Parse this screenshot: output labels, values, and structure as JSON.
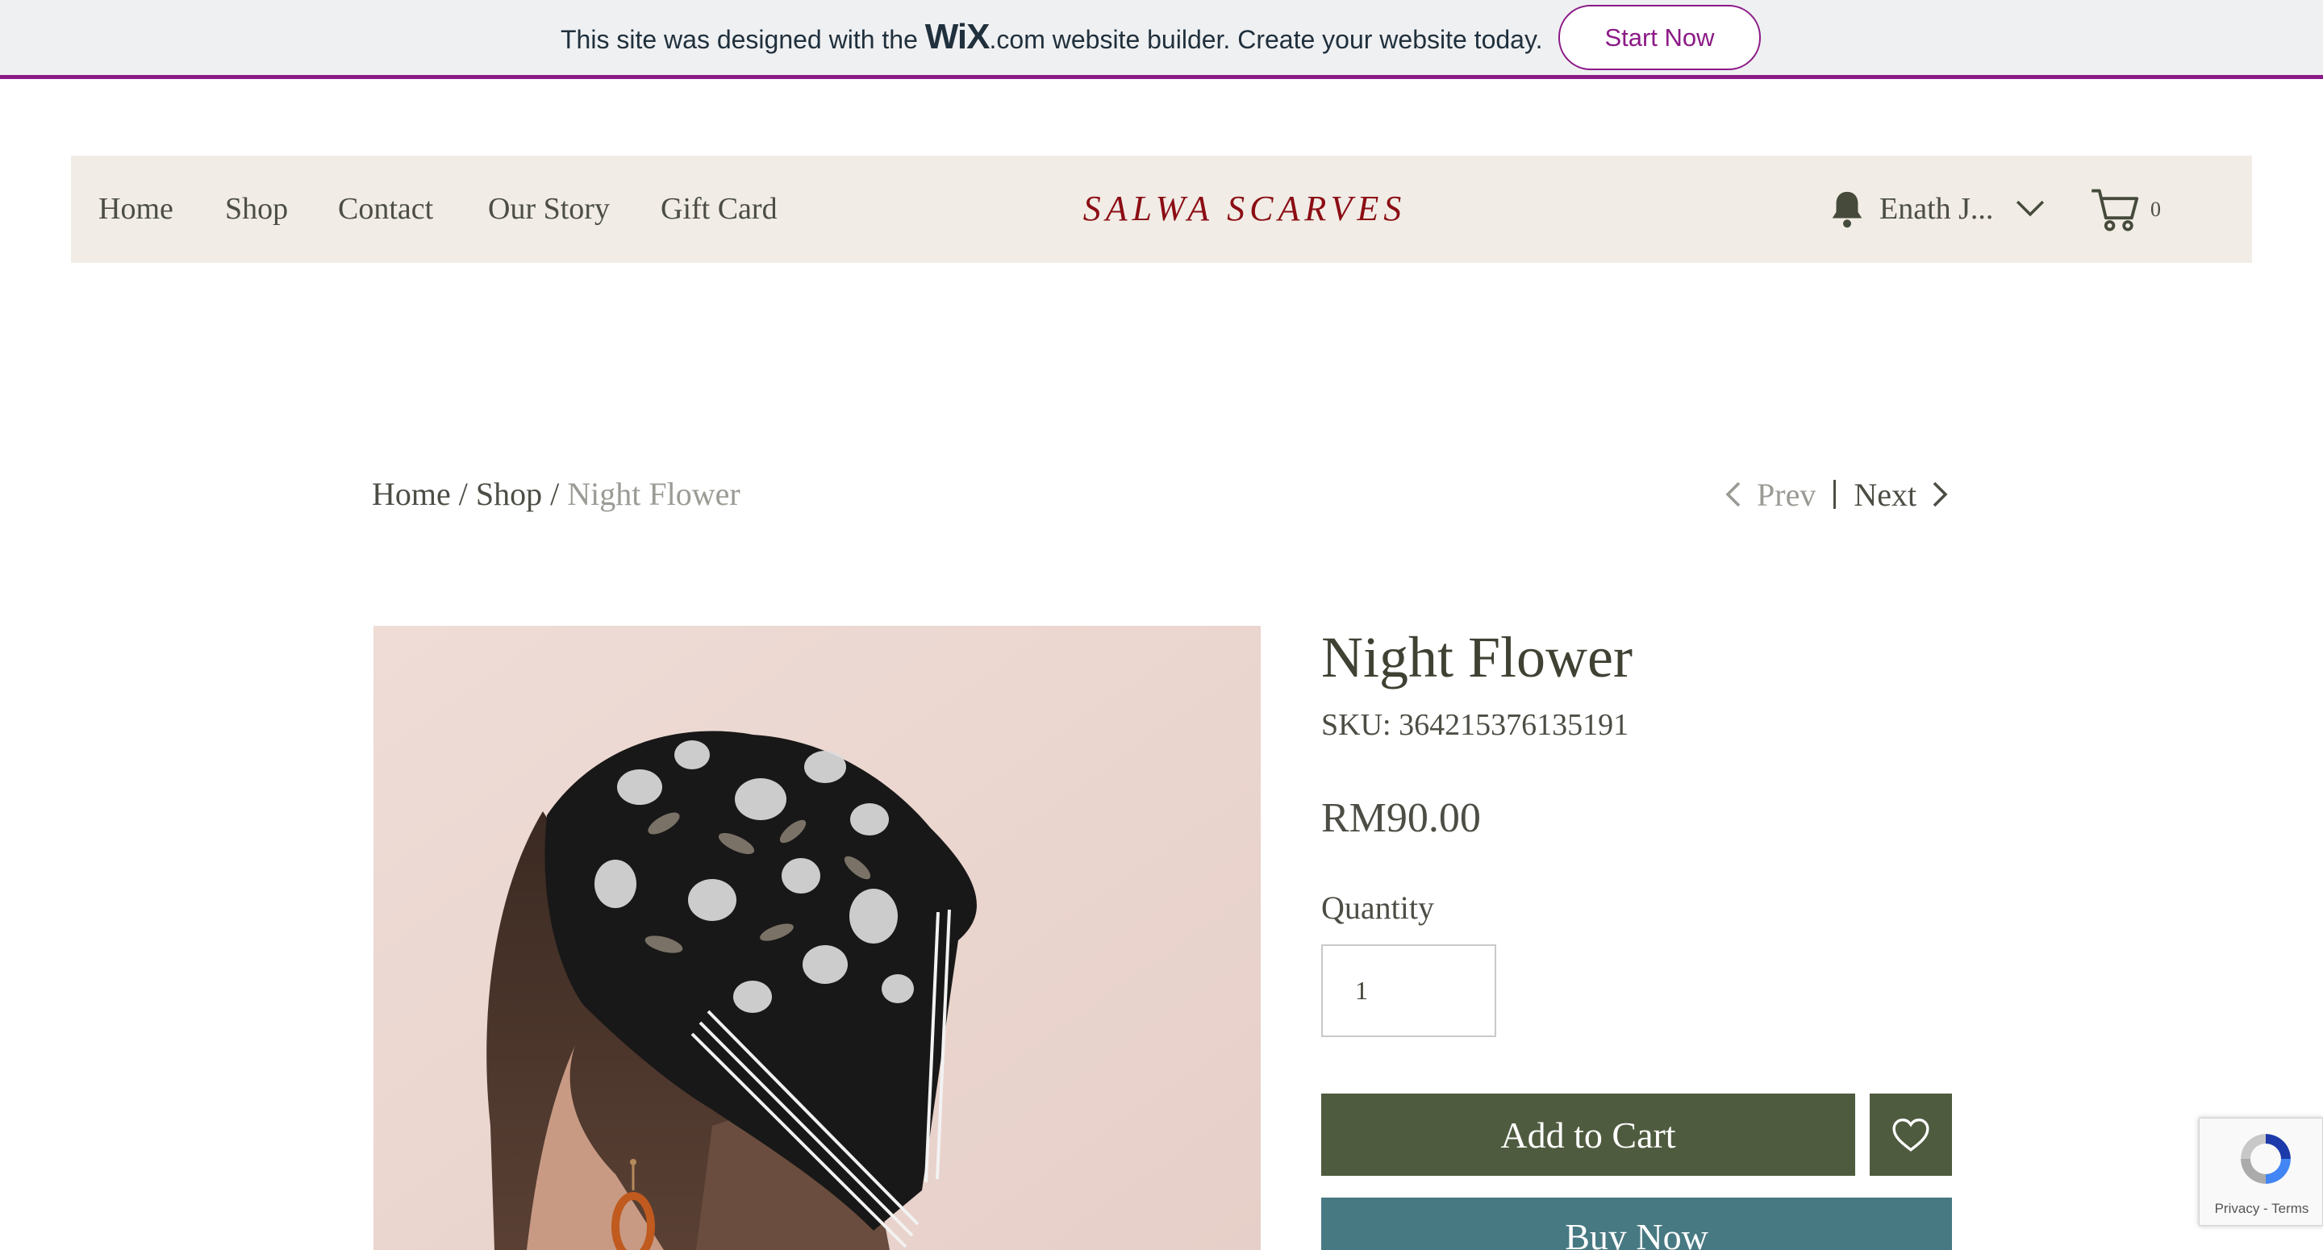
{
  "wix_banner": {
    "text_before": "This site was designed with the ",
    "logo_text": "WiX",
    "text_after": ".com website builder. Create your website today.",
    "cta_label": "Start Now",
    "accent_color": "#8b1a86"
  },
  "header": {
    "nav": [
      "Home",
      "Shop",
      "Contact",
      "Our Story",
      "Gift Card"
    ],
    "brand": "SALWA SCARVES",
    "brand_color": "#8b0d14",
    "user_name": "Enath J...",
    "cart_count": "0",
    "icons": [
      "bell-icon",
      "chevron-down-icon",
      "cart-icon"
    ]
  },
  "breadcrumb": {
    "items": [
      "Home",
      "Shop",
      "Night Flower"
    ],
    "separator": " / "
  },
  "pagination": {
    "prev_label": "Prev",
    "next_label": "Next"
  },
  "product": {
    "title": "Night Flower",
    "sku": "SKU: 364215376135191",
    "price": "RM90.00",
    "quantity_label": "Quantity",
    "quantity_value": "1",
    "add_to_cart_label": "Add to Cart",
    "buy_now_label": "Buy Now",
    "add_to_cart_color": "#4f5b3f",
    "buy_now_color": "#477982"
  },
  "recaptcha": {
    "links": "Privacy - Terms"
  }
}
